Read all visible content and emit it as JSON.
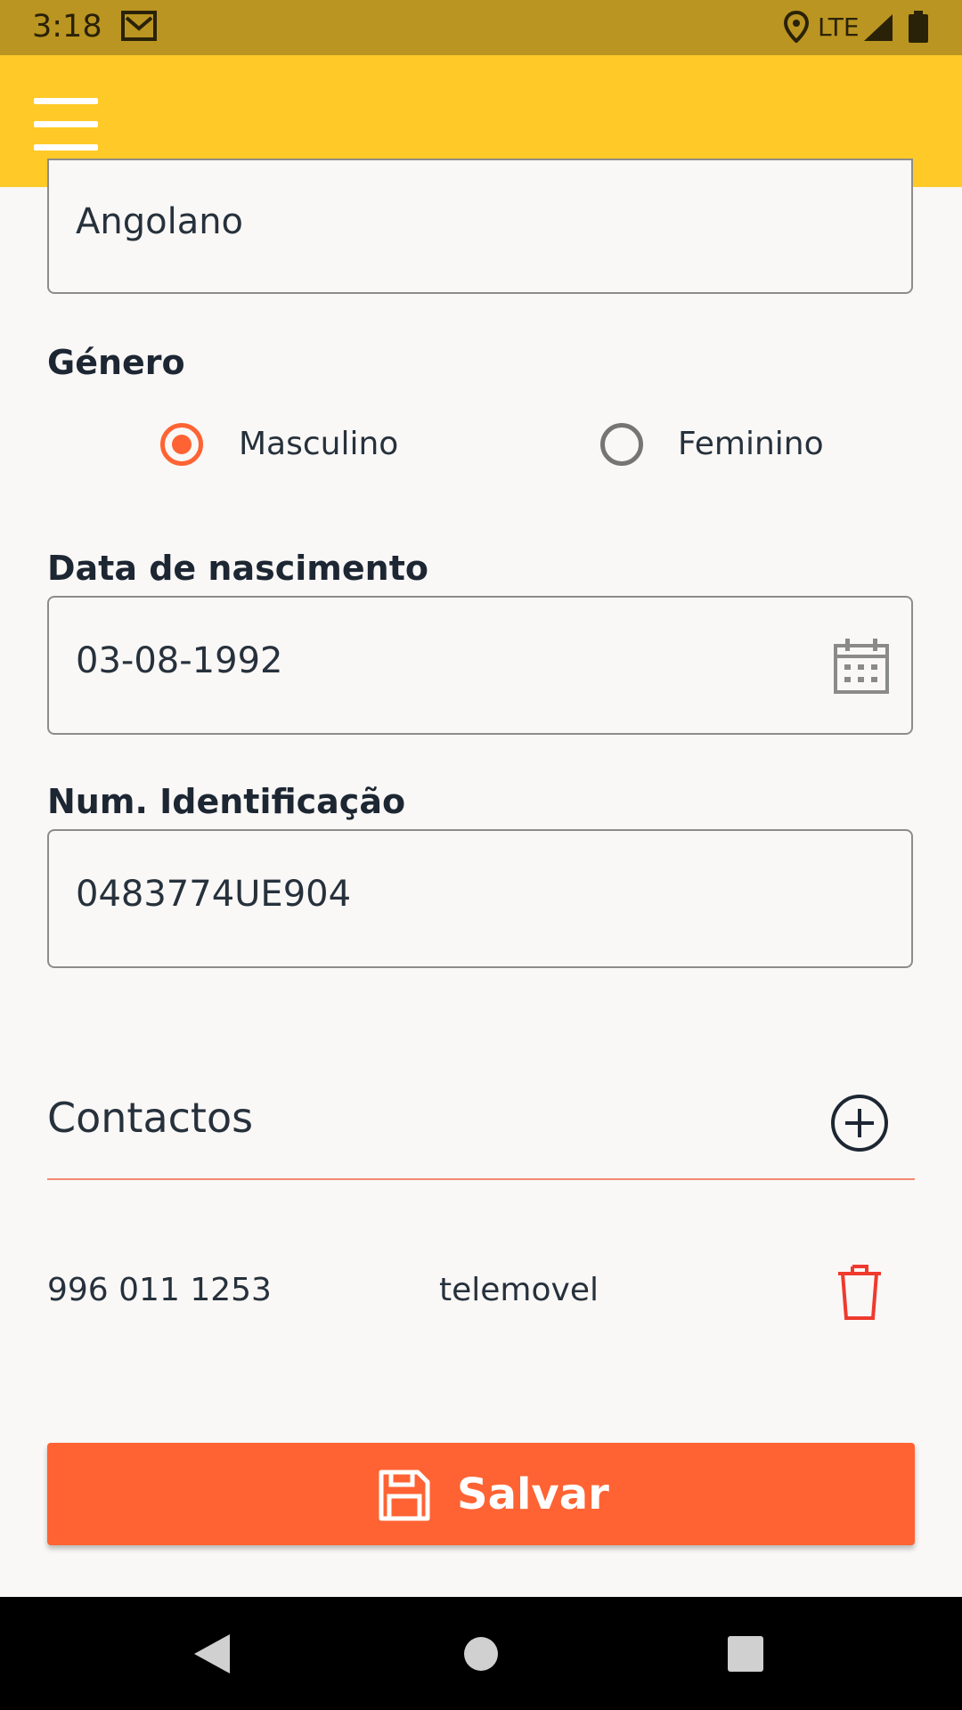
{
  "status_bar": {
    "time": "3:18",
    "network": "LTE",
    "icons": [
      "gmail-icon",
      "location-icon",
      "signal-icon",
      "battery-icon"
    ]
  },
  "app_bar": {
    "menu_icon": "hamburger-menu-icon",
    "color": "#ffc928"
  },
  "form": {
    "nationality_value": "Angolano",
    "gender": {
      "label": "Género",
      "options": [
        {
          "label": "Masculino",
          "selected": true
        },
        {
          "label": "Feminino",
          "selected": false
        }
      ]
    },
    "birth_date": {
      "label": "Data de nascimento",
      "value": "03-08-1992",
      "icon": "calendar-icon"
    },
    "id_number": {
      "label": "Num. Identificação",
      "value": "0483774UE904"
    }
  },
  "contacts": {
    "title": "Contactos",
    "add_icon": "add-circle-icon",
    "items": [
      {
        "number": "996 011 1253",
        "type": "telemovel",
        "delete_icon": "trash-icon"
      }
    ]
  },
  "save_button": {
    "label": "Salvar",
    "icon": "floppy-disk-icon",
    "color": "#ff6333"
  },
  "nav_bar": {
    "icons": [
      "back-icon",
      "home-icon",
      "recents-icon"
    ]
  }
}
